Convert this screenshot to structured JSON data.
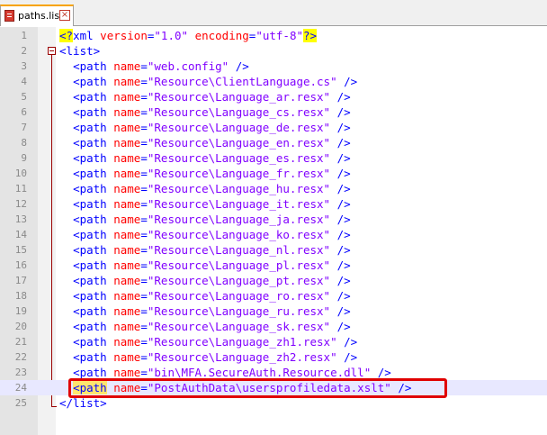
{
  "tab": {
    "label": "paths.list",
    "icon": "file-icon",
    "close_glyph": "×"
  },
  "colors": {
    "tag": "#0000ff",
    "attribute": "#ff0000",
    "value": "#8000ff",
    "highlight_box": "#e00000"
  },
  "lines": [
    {
      "num": "1",
      "type": "pi",
      "open": "<?",
      "name": "xml",
      "a1": "version",
      "v1": "\"1.0\"",
      "a2": "encoding",
      "v2": "\"utf-8\"",
      "close": "?>"
    },
    {
      "num": "2",
      "type": "open",
      "text": "<list>"
    },
    {
      "num": "3",
      "type": "path",
      "name": "\"web.config\""
    },
    {
      "num": "4",
      "type": "path",
      "name": "\"Resource\\ClientLanguage.cs\""
    },
    {
      "num": "5",
      "type": "path",
      "name": "\"Resource\\Language_ar.resx\""
    },
    {
      "num": "6",
      "type": "path",
      "name": "\"Resource\\Language_cs.resx\""
    },
    {
      "num": "7",
      "type": "path",
      "name": "\"Resource\\Language_de.resx\""
    },
    {
      "num": "8",
      "type": "path",
      "name": "\"Resource\\Language_en.resx\""
    },
    {
      "num": "9",
      "type": "path",
      "name": "\"Resource\\Language_es.resx\""
    },
    {
      "num": "10",
      "type": "path",
      "name": "\"Resource\\Language_fr.resx\""
    },
    {
      "num": "11",
      "type": "path",
      "name": "\"Resource\\Language_hu.resx\""
    },
    {
      "num": "12",
      "type": "path",
      "name": "\"Resource\\Language_it.resx\""
    },
    {
      "num": "13",
      "type": "path",
      "name": "\"Resource\\Language_ja.resx\""
    },
    {
      "num": "14",
      "type": "path",
      "name": "\"Resource\\Language_ko.resx\""
    },
    {
      "num": "15",
      "type": "path",
      "name": "\"Resource\\Language_nl.resx\""
    },
    {
      "num": "16",
      "type": "path",
      "name": "\"Resource\\Language_pl.resx\""
    },
    {
      "num": "17",
      "type": "path",
      "name": "\"Resource\\Language_pt.resx\""
    },
    {
      "num": "18",
      "type": "path",
      "name": "\"Resource\\Language_ro.resx\""
    },
    {
      "num": "19",
      "type": "path",
      "name": "\"Resource\\Language_ru.resx\""
    },
    {
      "num": "20",
      "type": "path",
      "name": "\"Resource\\Language_sk.resx\""
    },
    {
      "num": "21",
      "type": "path",
      "name": "\"Resource\\Language_zh1.resx\""
    },
    {
      "num": "22",
      "type": "path",
      "name": "\"Resource\\Language_zh2.resx\""
    },
    {
      "num": "23",
      "type": "path",
      "name": "\"bin\\MFA.SecureAuth.Resource.dll\""
    },
    {
      "num": "24",
      "type": "path",
      "name": "\"PostAuthData\\usersprofiledata.xslt\"",
      "active": true
    },
    {
      "num": "25",
      "type": "close",
      "text": "</list>"
    }
  ],
  "tokens": {
    "path_open": "<path",
    "attr_name": "name",
    "eq": "=",
    "self_close": "/>"
  }
}
